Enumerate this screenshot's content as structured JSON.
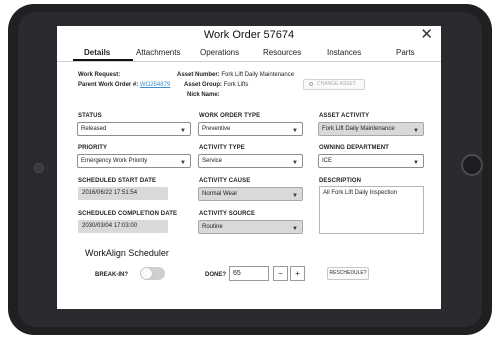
{
  "window": {
    "title": "Work Order 57674",
    "close_glyph": "✕"
  },
  "tabs": [
    {
      "label": "Details"
    },
    {
      "label": "Attachments"
    },
    {
      "label": "Operations"
    },
    {
      "label": "Resources"
    },
    {
      "label": "Instances"
    },
    {
      "label": "Parts"
    }
  ],
  "info": {
    "work_request_label": "Work Request:",
    "parent_wo_label": "Parent Work Order #:",
    "parent_wo_value": "WO254879",
    "asset_number_label": "Asset Number:",
    "asset_number_value": "Fork Lift Daily Maintenance",
    "asset_group_label": "Asset Group:",
    "asset_group_value": "Fork Lifts",
    "nick_name_label": "Nick Name:",
    "change_asset_label": "CHANGE ASSET"
  },
  "fields": {
    "status": {
      "label": "STATUS",
      "value": "Released"
    },
    "priority": {
      "label": "PRIORITY",
      "value": "Emergency Work Priority"
    },
    "scheduled_start": {
      "label": "SCHEDULED START DATE",
      "value": "2016/06/22 17:51:54"
    },
    "scheduled_completion": {
      "label": "SCHEDULED COMPLETION DATE",
      "value": "2030/03/04 17:03:00"
    },
    "work_order_type": {
      "label": "WORK ORDER TYPE",
      "value": "Preventive"
    },
    "activity_type": {
      "label": "ACTIVITY TYPE",
      "value": "Service"
    },
    "activity_cause": {
      "label": "ACTIVITY CAUSE",
      "value": "Normal Wear"
    },
    "activity_source": {
      "label": "ACTIVITY SOURCE",
      "value": "Routine"
    },
    "asset_activity": {
      "label": "ASSET ACTIVITY",
      "value": "Fork Lift Daily Maintenance"
    },
    "owning_department": {
      "label": "OWNING DEPARTMENT",
      "value": "ICE"
    },
    "description": {
      "label": "DESCRIPTION",
      "value": "All Fork Lift Daily Inspection"
    }
  },
  "scheduler": {
    "title": "WorkAlign Scheduler",
    "break_in_label": "BREAK-IN?",
    "break_in_on": false,
    "done_label": "DONE?",
    "done_value": "65",
    "minus_label": "−",
    "plus_label": "+",
    "reschedule_label": "RESCHEDULE?"
  },
  "icons": {
    "dropdown": "chevron-down-icon",
    "close": "close-icon",
    "search": "search-icon"
  }
}
